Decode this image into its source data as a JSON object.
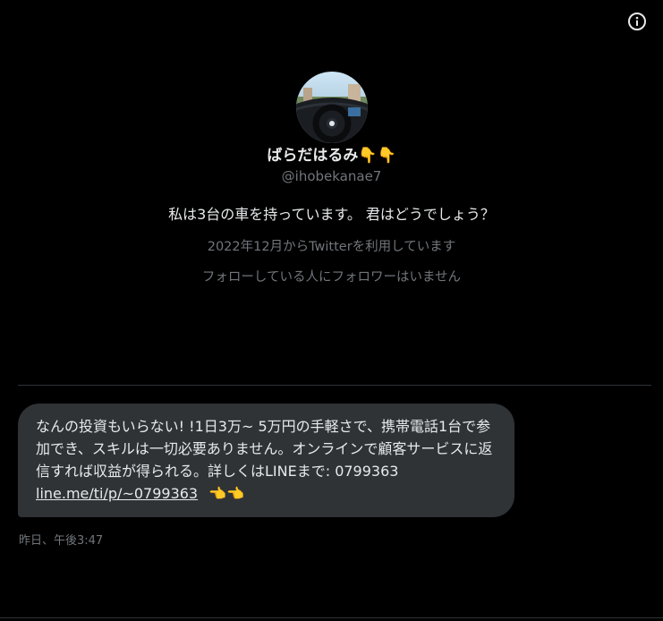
{
  "header": {
    "info_icon": "info-circle-icon"
  },
  "profile": {
    "avatar_icon": "car-interior-photo",
    "display_name": "ばらだはるみ",
    "display_name_emoji": "👇👇",
    "handle": "@ihobekanae7",
    "bio": "私は3台の車を持っています。 君はどうでしょう？",
    "joined": "2022年12月からTwitterを利用しています",
    "followers_note": "フォローしている人にフォロワーはいません"
  },
  "message": {
    "text_part1": "なんの投資もいらない! !1日3万~ 5万円の手軽さで、携帯電話1台で参加でき、スキルは一切必要ありません。オンラインで顧客サービスに返信すれば収益が得られる。詳しくはLINEまで:  0799363  ",
    "link": "line.me/ti/p/~0799363",
    "emoji": "👈👈",
    "timestamp": "昨日、午後3:47"
  },
  "colors": {
    "background": "#000000",
    "bubble": "#2f3336",
    "text_primary": "#e7e9ea",
    "text_secondary": "#71767b",
    "divider": "#2f3336"
  }
}
